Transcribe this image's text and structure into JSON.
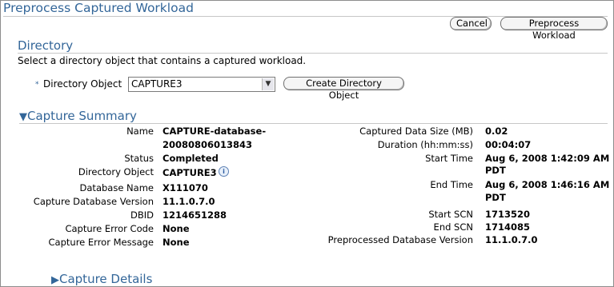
{
  "page": {
    "title": "Preprocess Captured Workload"
  },
  "toolbar": {
    "cancel_label": "Cancel",
    "preprocess_label": "Preprocess Workload"
  },
  "directory": {
    "heading": "Directory",
    "instruction": "Select a directory object that contains a captured workload.",
    "required_marker": "*",
    "label": "Directory Object",
    "selected_value": "CAPTURE3",
    "create_button": "Create Directory Object"
  },
  "summary": {
    "heading": "Capture Summary",
    "left": [
      {
        "label": "Name",
        "value": "CAPTURE-database-"
      },
      {
        "label": "",
        "value": "20080806013843"
      },
      {
        "label": "Status",
        "value": "Completed"
      },
      {
        "label": "Directory Object",
        "value": "CAPTURE3"
      },
      {
        "label": "Database Name",
        "value": "X111070"
      },
      {
        "label": "Capture Database Version",
        "value": "11.1.0.7.0"
      },
      {
        "label": "DBID",
        "value": "1214651288"
      },
      {
        "label": "Capture Error Code",
        "value": "None"
      },
      {
        "label": "Capture Error Message",
        "value": "None"
      }
    ],
    "right": [
      {
        "label": "Captured Data Size (MB)",
        "value": "0.02"
      },
      {
        "label": "Duration (hh:mm:ss)",
        "value": "00:04:07"
      },
      {
        "label": "Start Time",
        "value": "Aug 6, 2008 1:42:09 AM"
      },
      {
        "label": "",
        "value": "PDT"
      },
      {
        "label": "End Time",
        "value": "Aug 6, 2008 1:46:16 AM"
      },
      {
        "label": "",
        "value": "PDT"
      },
      {
        "label": "Start SCN",
        "value": "1713520"
      },
      {
        "label": "End SCN",
        "value": "1714085"
      },
      {
        "label": "Preprocessed Database Version",
        "value": "11.1.0.7.0"
      }
    ]
  },
  "details": {
    "heading": "Capture Details"
  },
  "icons": {
    "expanded": "triangle-down-icon",
    "collapsed": "triangle-right-icon",
    "info": "info-icon",
    "dropdown": "chevron-down-icon"
  },
  "colors": {
    "heading": "#336699"
  }
}
